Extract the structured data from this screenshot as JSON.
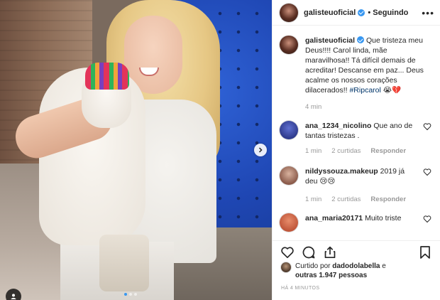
{
  "post": {
    "author": "galisteuoficial",
    "follow_status": "Seguindo",
    "more_symbol": "•••",
    "carousel": {
      "slides": 3,
      "active_index": 0
    }
  },
  "caption": {
    "username": "galisteuoficial",
    "text": "Que tristeza meu Deus!!!! Carol linda, mãe maravilhosa!! Tá difícil demais de acreditar! Descanse em paz... Deus acalme os nossos corações dilacerados!!",
    "hashtag": "#Ripcarol",
    "emoji": "😭💔",
    "time": "4 min"
  },
  "comments": [
    {
      "username": "ana_1234_nicolino",
      "text": "Que ano de tantas tristezas .",
      "time": "1 min",
      "likes": "2 curtidas",
      "reply_label": "Responder",
      "avatar_color": "#2e3a8c"
    },
    {
      "username": "nildyssouza.makeup",
      "text": "2019 já deu 😢😢",
      "time": "1 min",
      "likes": "2 curtidas",
      "reply_label": "Responder",
      "avatar_color": "#8a5a4a"
    },
    {
      "username": "ana_maria20171",
      "text": "Muito triste",
      "avatar_color": "#c0563a"
    }
  ],
  "likes_summary": {
    "prefix": "Curtido por",
    "user": "dadodolabella",
    "suffix": "e",
    "others": "outras 1.947 pessoas"
  },
  "timestamp": "HÁ 4 MINUTOS",
  "icons": {
    "like": "heart-icon",
    "comment": "comment-icon",
    "share": "share-icon",
    "save": "bookmark-icon",
    "next": "chevron-right-icon",
    "tag": "user-tag-icon"
  },
  "colors": {
    "verified": "#3897f0",
    "hashtag": "#003569",
    "muted": "#999999",
    "text": "#262626"
  }
}
